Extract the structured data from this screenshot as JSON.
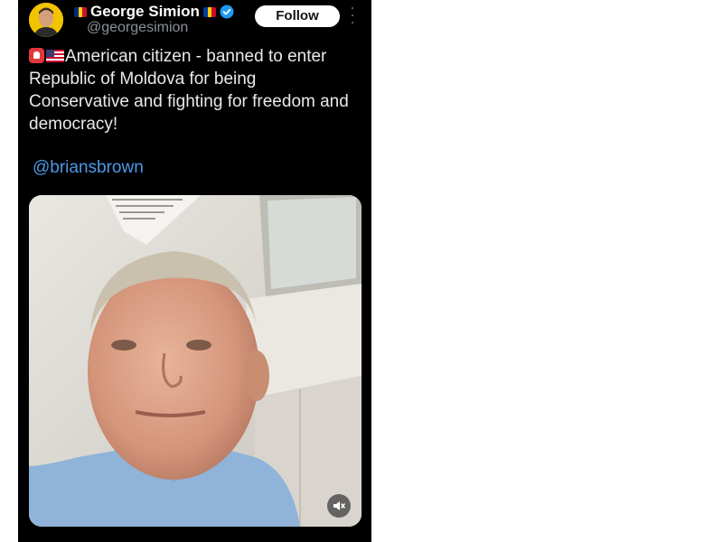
{
  "author": {
    "display_name": "George Simion",
    "handle": "@georgesimion",
    "verified": true,
    "flags": [
      "romania-flag",
      "moldova-flag"
    ],
    "avatar": "avatar"
  },
  "actions": {
    "follow_label": "Follow",
    "more_icon": "more-vertical-icon"
  },
  "tweet": {
    "emojis": [
      "police-light-emoji",
      "us-flag-emoji"
    ],
    "text": "American citizen - banned to enter Republic of Moldova for being Conservative and fighting for freedom and democracy!",
    "mention": "@briansbrown"
  },
  "media": {
    "type": "video",
    "mute_icon": "muted-speaker-icon"
  },
  "colors": {
    "background": "#000000",
    "text": "#e7e9ea",
    "secondary_text": "#8b9096",
    "link": "#4a99e9",
    "verified": "#1d9bf0",
    "follow_button_bg": "#ffffff"
  }
}
